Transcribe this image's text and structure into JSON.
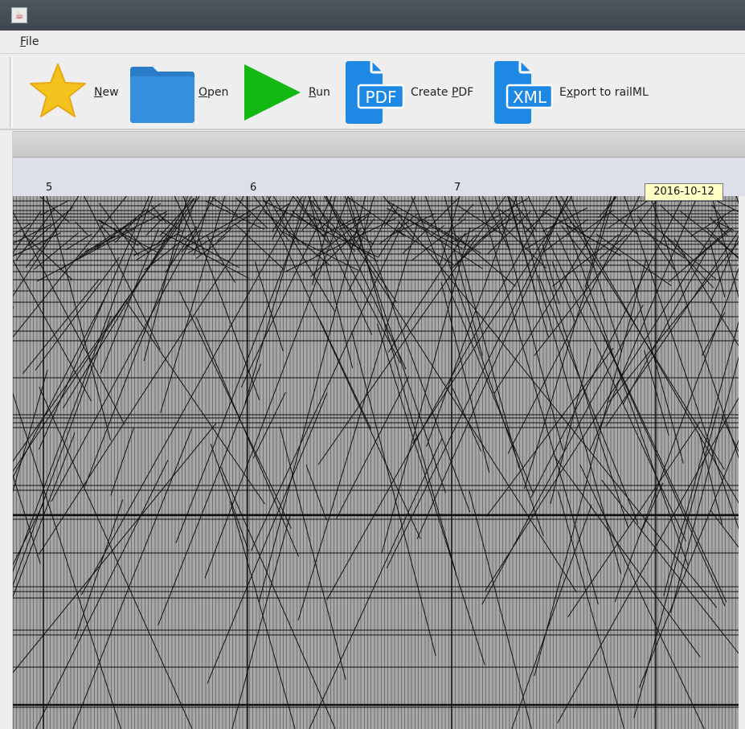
{
  "window": {
    "title": ""
  },
  "menu": {
    "file_mnemonic": "F",
    "file_rest": "ile"
  },
  "toolbar": {
    "new": {
      "mn": "N",
      "rest": "ew"
    },
    "open": {
      "mn": "O",
      "rest": "pen"
    },
    "run": {
      "mn": "R",
      "rest": "un"
    },
    "pdf": {
      "pre": "Create ",
      "mn": "P",
      "rest": "DF",
      "icon_text": "PDF"
    },
    "xml": {
      "pre": "E",
      "mn": "x",
      "rest": "port to railML",
      "icon_text": "XML"
    }
  },
  "timeline": {
    "hours": [
      "5",
      "6",
      "7"
    ],
    "tooltip": "2016-10-12"
  },
  "colors": {
    "star": "#f3c21d",
    "folder": "#2f86d6",
    "run": "#14b814",
    "doc": "#1e88e5",
    "graph_bg": "#a7a7a7"
  }
}
